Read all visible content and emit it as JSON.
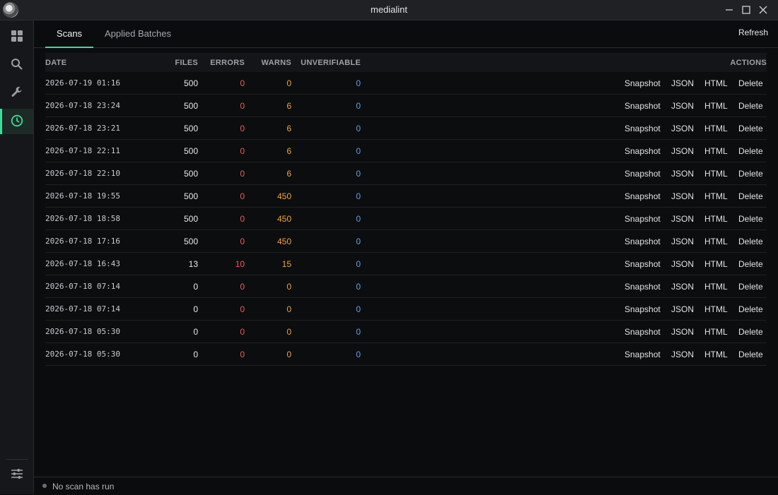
{
  "window": {
    "title": "medialint"
  },
  "sidebar": {
    "items": [
      {
        "icon": "dashboard-icon",
        "active": false
      },
      {
        "icon": "search-icon",
        "active": false
      },
      {
        "icon": "wrench-icon",
        "active": false
      },
      {
        "icon": "history-icon",
        "active": true
      }
    ],
    "bottom_icon": "sliders-icon"
  },
  "tabs": [
    {
      "label": "Scans",
      "active": true
    },
    {
      "label": "Applied Batches",
      "active": false
    }
  ],
  "refresh_label": "Refresh",
  "table": {
    "headers": {
      "date": "DATE",
      "files": "FILES",
      "errors": "ERRORS",
      "warns": "WARNS",
      "unverifiable": "UNVERIFIABLE",
      "actions": "ACTIONS"
    },
    "action_labels": {
      "snapshot": "Snapshot",
      "json": "JSON",
      "html": "HTML",
      "delete": "Delete"
    },
    "rows": [
      {
        "date": "2026-07-19 01:16",
        "files": "500",
        "errors": "0",
        "warns": "0",
        "unverifiable": "0"
      },
      {
        "date": "2026-07-18 23:24",
        "files": "500",
        "errors": "0",
        "warns": "6",
        "unverifiable": "0"
      },
      {
        "date": "2026-07-18 23:21",
        "files": "500",
        "errors": "0",
        "warns": "6",
        "unverifiable": "0"
      },
      {
        "date": "2026-07-18 22:11",
        "files": "500",
        "errors": "0",
        "warns": "6",
        "unverifiable": "0"
      },
      {
        "date": "2026-07-18 22:10",
        "files": "500",
        "errors": "0",
        "warns": "6",
        "unverifiable": "0"
      },
      {
        "date": "2026-07-18 19:55",
        "files": "500",
        "errors": "0",
        "warns": "450",
        "unverifiable": "0"
      },
      {
        "date": "2026-07-18 18:58",
        "files": "500",
        "errors": "0",
        "warns": "450",
        "unverifiable": "0"
      },
      {
        "date": "2026-07-18 17:16",
        "files": "500",
        "errors": "0",
        "warns": "450",
        "unverifiable": "0"
      },
      {
        "date": "2026-07-18 16:43",
        "files": "13",
        "errors": "10",
        "warns": "15",
        "unverifiable": "0"
      },
      {
        "date": "2026-07-18 07:14",
        "files": "0",
        "errors": "0",
        "warns": "0",
        "unverifiable": "0"
      },
      {
        "date": "2026-07-18 07:14",
        "files": "0",
        "errors": "0",
        "warns": "0",
        "unverifiable": "0"
      },
      {
        "date": "2026-07-18 05:30",
        "files": "0",
        "errors": "0",
        "warns": "0",
        "unverifiable": "0"
      },
      {
        "date": "2026-07-18 05:30",
        "files": "0",
        "errors": "0",
        "warns": "0",
        "unverifiable": "0"
      }
    ]
  },
  "status": {
    "text": "No scan has run"
  },
  "colors": {
    "accent": "#3ddc97",
    "errors": "#ee5a52",
    "warns": "#f0a23b",
    "unverifiable": "#5aa3e6"
  }
}
